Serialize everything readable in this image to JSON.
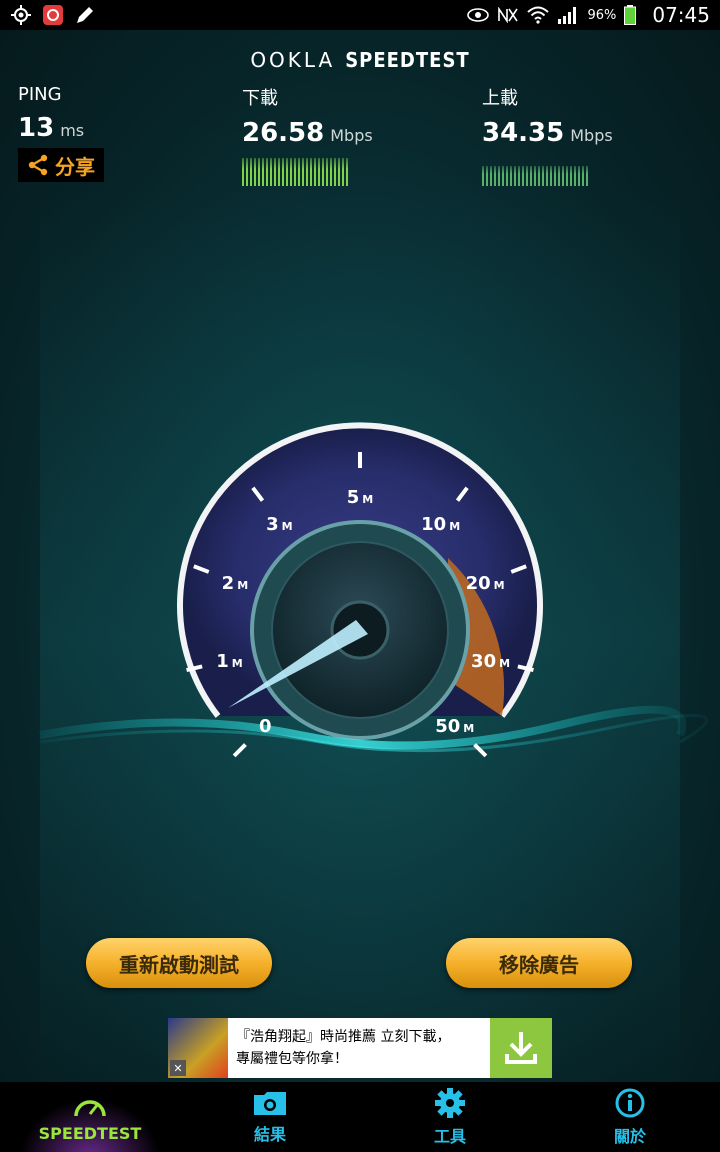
{
  "status_bar": {
    "battery": "96%",
    "time": "07:45"
  },
  "header": {
    "brand_ookla": "OOKLA",
    "brand_speedtest": "SPEEDTEST"
  },
  "metrics": {
    "ping": {
      "label": "PING",
      "value": "13",
      "unit": "ms"
    },
    "download": {
      "label": "下載",
      "value": "26.58",
      "unit": "Mbps"
    },
    "upload": {
      "label": "上載",
      "value": "34.35",
      "unit": "Mbps"
    }
  },
  "share_label": "分享",
  "gauge": {
    "ticks": [
      {
        "text": "0",
        "sub": ""
      },
      {
        "text": "1",
        "sub": "M"
      },
      {
        "text": "2",
        "sub": "M"
      },
      {
        "text": "3",
        "sub": "M"
      },
      {
        "text": "5",
        "sub": "M"
      },
      {
        "text": "10",
        "sub": "M"
      },
      {
        "text": "20",
        "sub": "M"
      },
      {
        "text": "30",
        "sub": "M"
      },
      {
        "text": "50",
        "sub": "M"
      }
    ]
  },
  "actions": {
    "restart": "重新啟動測試",
    "remove_ads": "移除廣告"
  },
  "ad": {
    "line1": "『浩角翔起』時尚推薦 立刻下載，",
    "line2": "專屬禮包等你拿！",
    "close": "✕"
  },
  "nav": [
    {
      "label": "SPEEDTEST",
      "icon": "speedometer-icon"
    },
    {
      "label": "結果",
      "icon": "folder-camera-icon"
    },
    {
      "label": "工具",
      "icon": "gear-icon"
    },
    {
      "label": "關於",
      "icon": "info-icon"
    }
  ],
  "colors": {
    "accent_orange": "#f7a423",
    "nav_blue": "#27c0e8",
    "nav_active_green": "#9be63a",
    "gauge_purple": "#7a5bd6",
    "gauge_orange": "#c26a1e"
  }
}
